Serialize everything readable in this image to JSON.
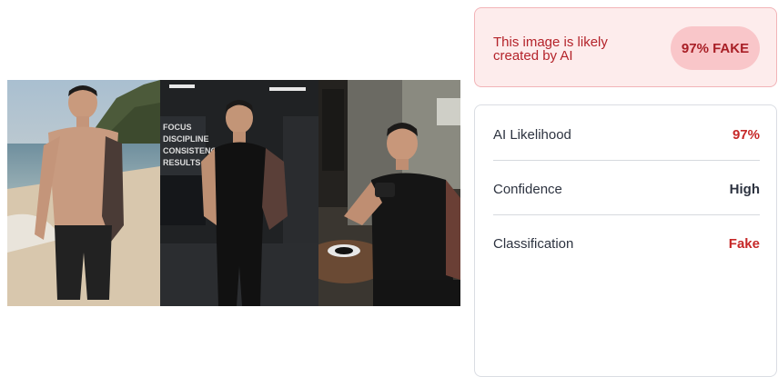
{
  "result": {
    "message": "This image is likely created by AI",
    "badge": "97% FAKE"
  },
  "details": [
    {
      "label": "AI Likelihood",
      "value": "97%",
      "value_color": "#c62828"
    },
    {
      "label": "Confidence",
      "value": "High",
      "value_color": "#2d3340"
    },
    {
      "label": "Classification",
      "value": "Fake",
      "value_color": "#c62828"
    }
  ],
  "images": [
    {
      "scene": "beach"
    },
    {
      "scene": "gym"
    },
    {
      "scene": "cafe"
    }
  ],
  "colors": {
    "alert_bg": "#fdecec",
    "alert_border": "#f2b4b8",
    "badge_bg": "#f9c6c9",
    "alert_text": "#b4232a"
  }
}
